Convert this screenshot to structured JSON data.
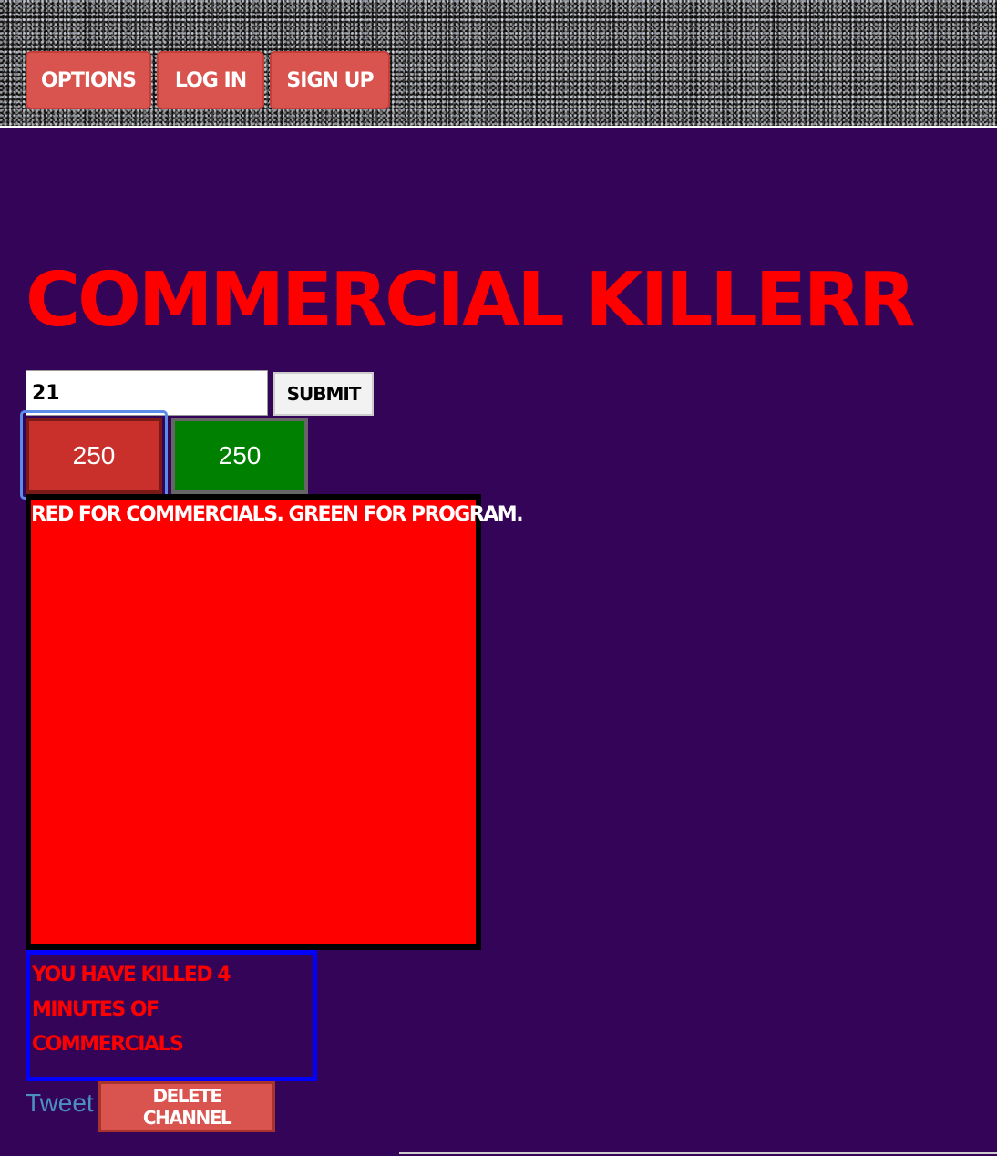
{
  "nav": {
    "options_label": "Options",
    "login_label": "Log In",
    "signup_label": "Sign Up"
  },
  "page": {
    "title": "Commercial Killerr"
  },
  "form": {
    "channel_value": "21",
    "submit_label": "Submit"
  },
  "counters": {
    "commercial_count": "250",
    "program_count": "250"
  },
  "display": {
    "instruction": "Red for commercials. Green for program.",
    "background_color": "#ff0000"
  },
  "stats": {
    "killed_text": "You have killed 4 minutes of commercials"
  },
  "footer": {
    "tweet_label": "Tweet",
    "delete_label": "Delete Channel"
  },
  "colors": {
    "page_background": "#330457",
    "nav_button": "#d9534f",
    "commercial_button": "#c9302c",
    "program_button": "#008000",
    "stats_border": "#0000ff"
  }
}
